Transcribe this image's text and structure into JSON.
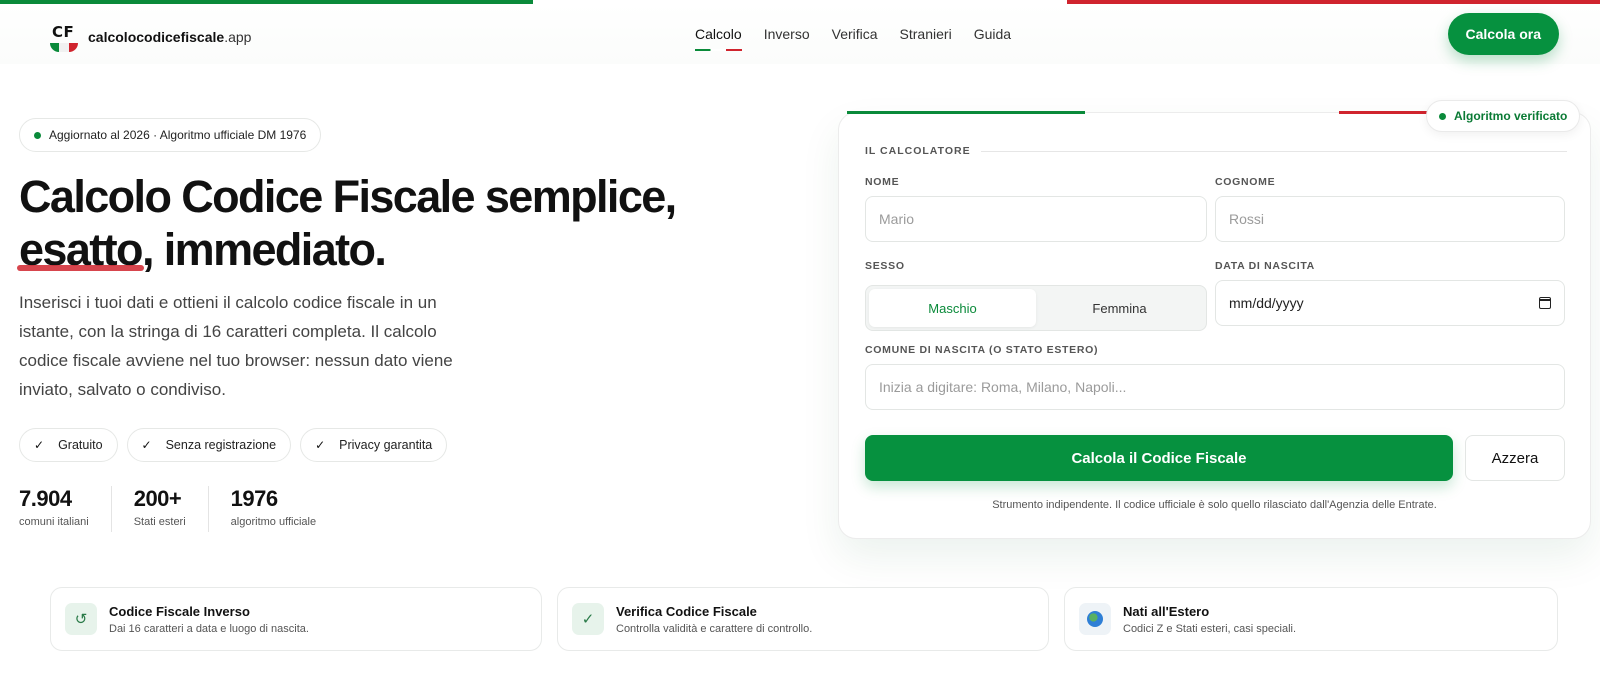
{
  "brand": {
    "badge": "CF",
    "name": "calcolocodicefiscale",
    "tld": ".app"
  },
  "nav": {
    "items": [
      "Calcolo",
      "Inverso",
      "Verifica",
      "Stranieri",
      "Guida"
    ],
    "active": "Calcolo"
  },
  "header": {
    "cta_label": "Calcola ora"
  },
  "hero": {
    "badge": "Aggiornato al 2026 · Algoritmo ufficiale DM 1976",
    "title_line1": "Calcolo Codice Fiscale semplice,",
    "title_emph": "esatto",
    "title_rest": ", immediato.",
    "lead": "Inserisci i tuoi dati e ottieni il calcolo codice fiscale in un istante, con la stringa di 16 caratteri completa. Il calcolo codice fiscale avviene nel tuo browser: nessun dato viene inviato, salvato o condiviso.",
    "chips": [
      "Gratuito",
      "Senza registrazione",
      "Privacy garantita"
    ],
    "check_glyph": "✓",
    "stats": [
      {
        "value": "7.904",
        "label": "comuni italiani"
      },
      {
        "value": "200+",
        "label": "Stati esteri"
      },
      {
        "value": "1976",
        "label": "algoritmo ufficiale"
      }
    ]
  },
  "calculator": {
    "verified_badge": "Algoritmo verificato",
    "section_title": "IL CALCOLATORE",
    "nome": {
      "label": "NOME",
      "placeholder": "Mario",
      "value": ""
    },
    "cognome": {
      "label": "COGNOME",
      "placeholder": "Rossi",
      "value": ""
    },
    "sesso": {
      "label": "SESSO",
      "options": [
        "Maschio",
        "Femmina"
      ],
      "selected": "Maschio"
    },
    "data": {
      "label": "DATA DI NASCITA",
      "placeholder": "mm/dd/yyyy"
    },
    "comune": {
      "label": "COMUNE DI NASCITA (O STATO ESTERO)",
      "placeholder": "Inizia a digitare: Roma, Milano, Napoli..."
    },
    "submit_label": "Calcola il Codice Fiscale",
    "reset_label": "Azzera",
    "disclaimer": "Strumento indipendente. Il codice ufficiale è solo quello rilasciato dall'Agenzia delle Entrate."
  },
  "features": [
    {
      "icon": "refresh-icon",
      "glyph": "↺",
      "title": "Codice Fiscale Inverso",
      "subtitle": "Dai 16 caratteri a data e luogo di nascita."
    },
    {
      "icon": "check-icon",
      "glyph": "✓",
      "title": "Verifica Codice Fiscale",
      "subtitle": "Controlla validità e carattere di controllo."
    },
    {
      "icon": "globe-icon",
      "glyph": "",
      "title": "Nati all'Estero",
      "subtitle": "Codici Z e Stati esteri, casi speciali."
    }
  ],
  "colors": {
    "brand_green": "#06913f",
    "flag_red": "#d0242e",
    "flag_white": "#ffffff"
  }
}
